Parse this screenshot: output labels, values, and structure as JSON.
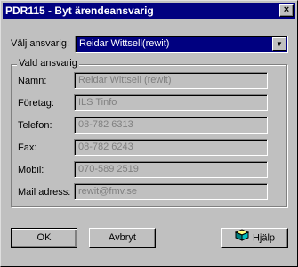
{
  "window": {
    "title": "PDR115 - Byt ärendeansvarig",
    "close_glyph": "×"
  },
  "selector": {
    "label": "Välj ansvarig:",
    "selected_value": "Reidar Wittsell(rewit)",
    "dropdown_glyph": "▼"
  },
  "group": {
    "title": "Vald ansvarig",
    "fields": [
      {
        "label": "Namn:",
        "value": "Reidar Wittsell (rewit)"
      },
      {
        "label": "Företag:",
        "value": "ILS Tinfo"
      },
      {
        "label": "Telefon:",
        "value": "08-782 6313"
      },
      {
        "label": "Fax:",
        "value": "08-782 6243"
      },
      {
        "label": "Mobil:",
        "value": "070-589 2519"
      },
      {
        "label": "Mail adress:",
        "value": "rewit@fmv.se"
      }
    ]
  },
  "buttons": {
    "ok_label": "OK",
    "cancel_label": "Avbryt",
    "help_label": "Hjälp"
  },
  "colors": {
    "titlebar": "#000080",
    "face": "#c0c0c0",
    "disabled_text": "#808080"
  },
  "icons": {
    "help": "help-book-icon",
    "close": "close-icon",
    "dropdown": "chevron-down-icon"
  }
}
